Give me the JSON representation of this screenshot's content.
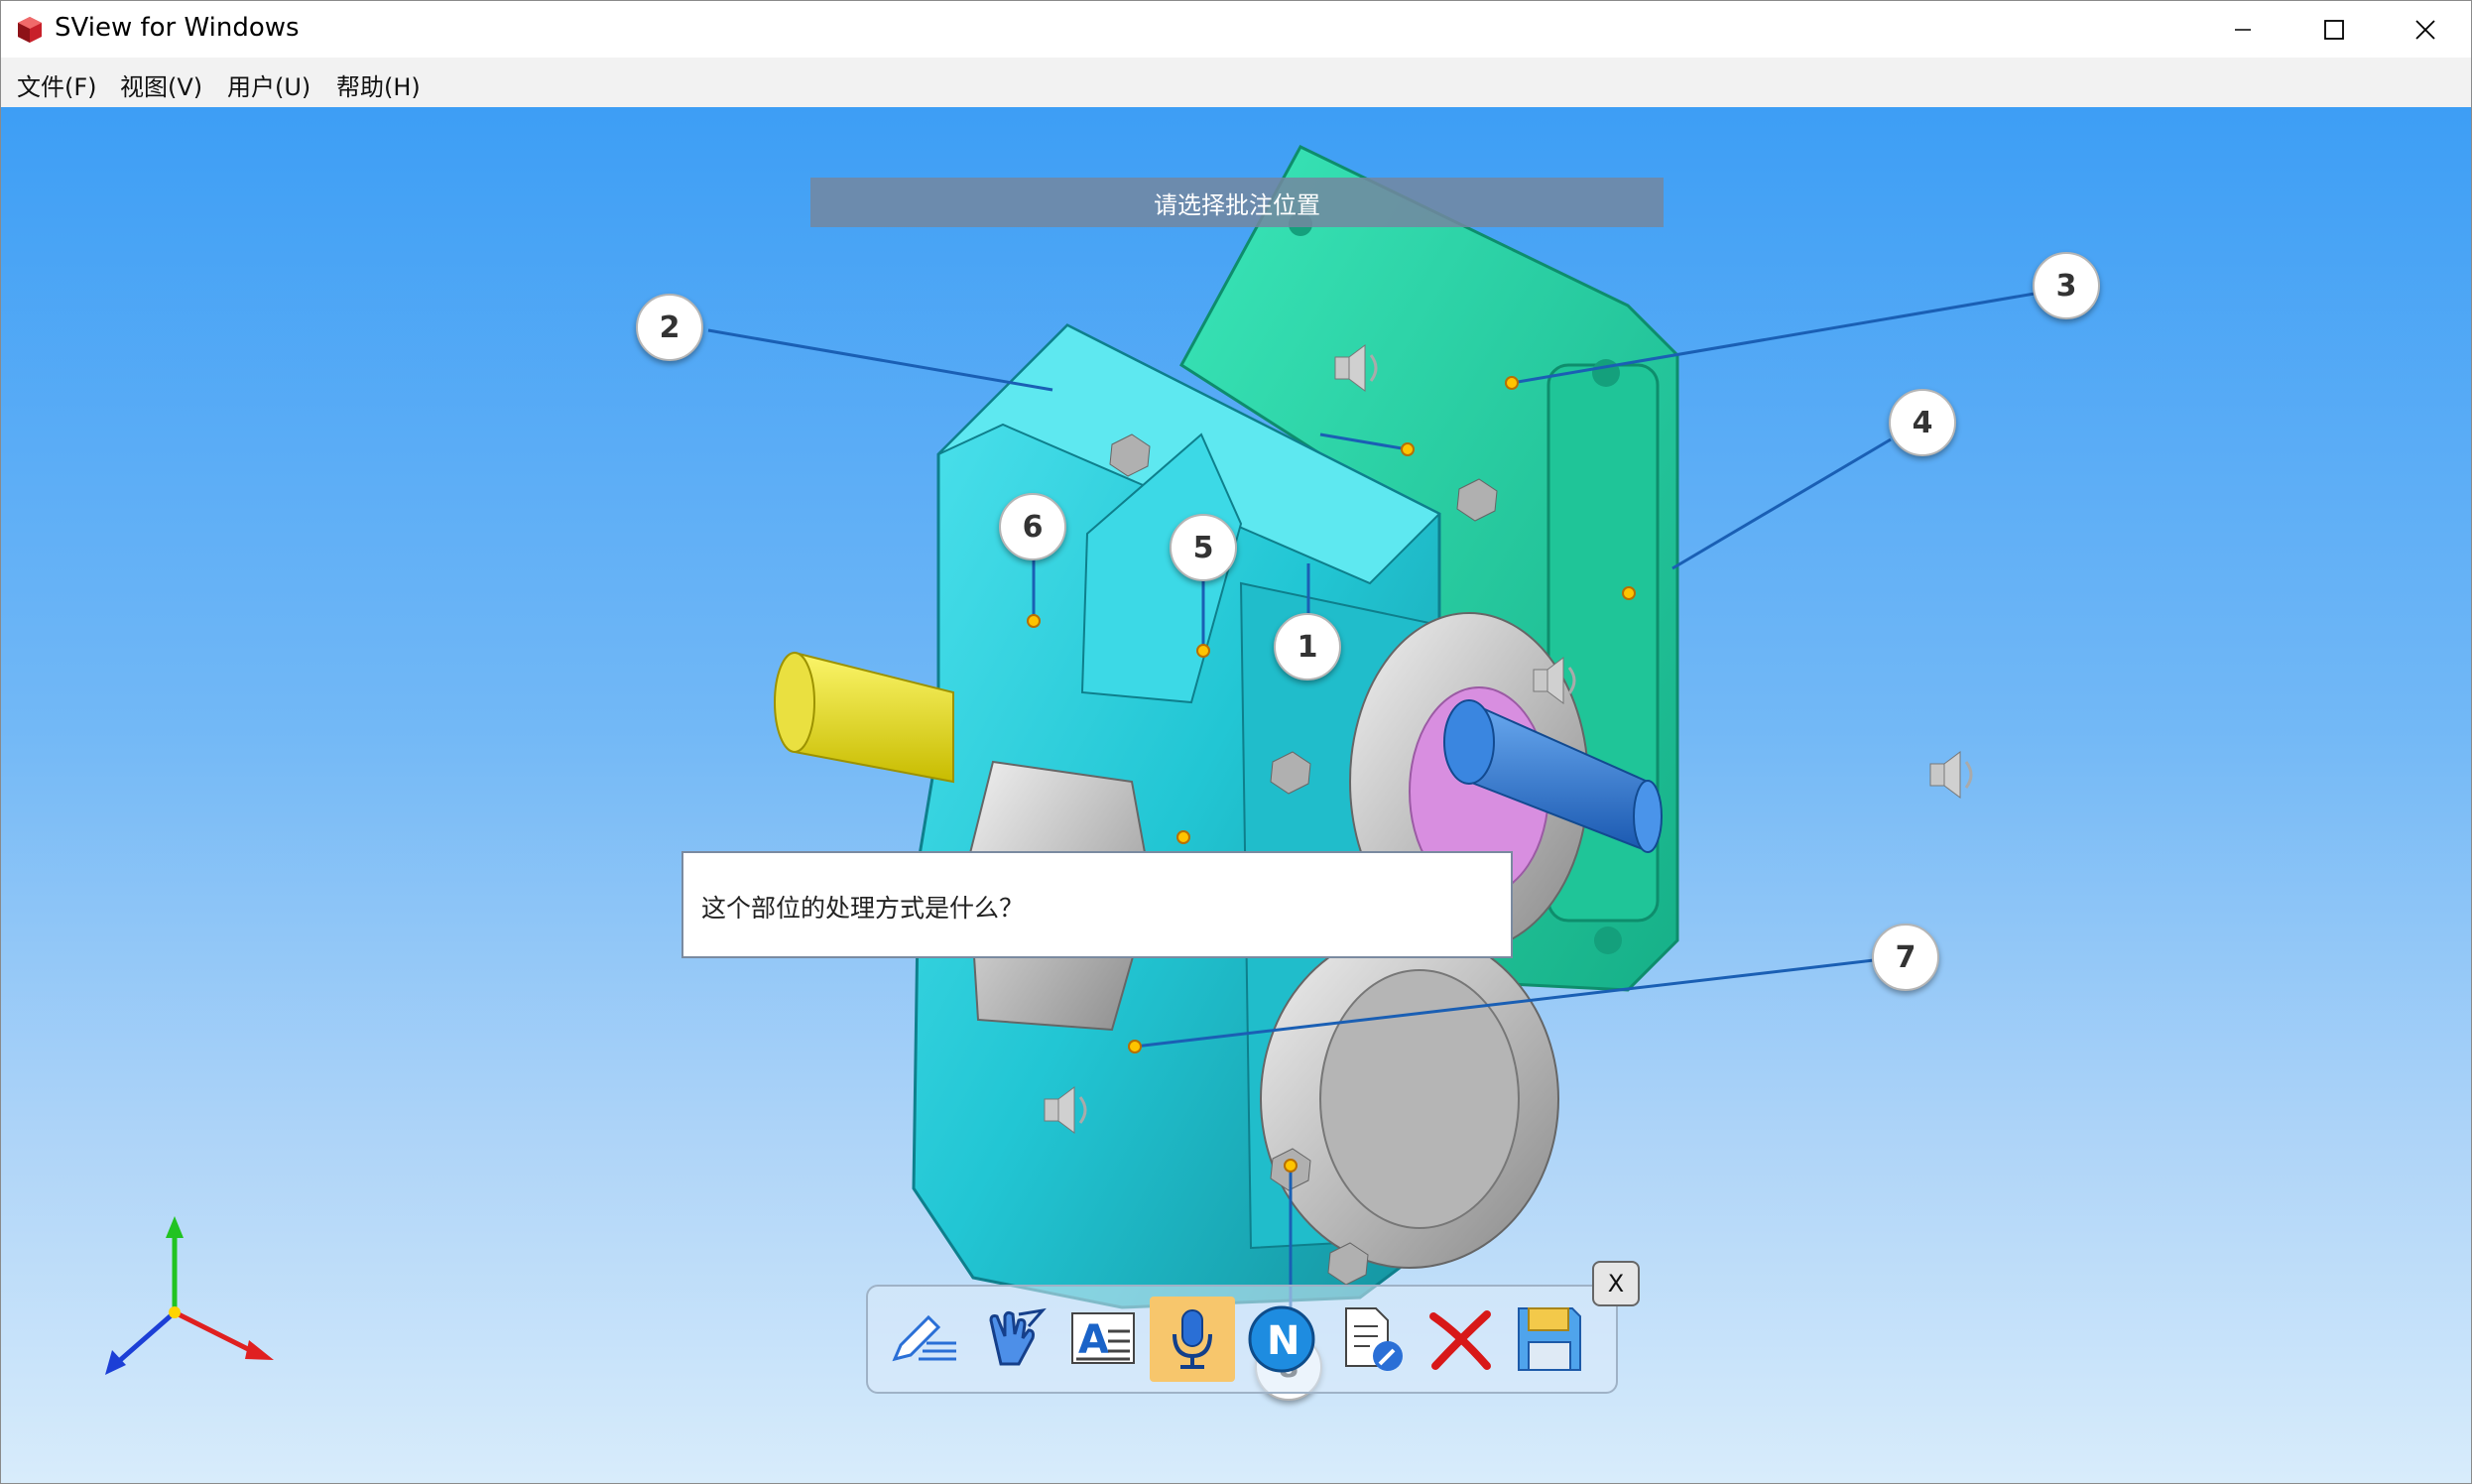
{
  "window": {
    "title": "SView for Windows"
  },
  "menu": [
    "文件(F)",
    "视图(V)",
    "用户(U)",
    "帮助(H)"
  ],
  "viewport": {
    "status_banner": "请选择批注位置",
    "note_text": "这个部位的处理方式是什么？",
    "balloons": [
      "1",
      "2",
      "3",
      "4",
      "5",
      "6",
      "7",
      "8"
    ],
    "toolbar_close": "X",
    "toolbar": [
      "pencil-annotation-icon",
      "hand-pointer-icon",
      "text-document-icon",
      "microphone-icon",
      "n-circle-icon",
      "document-edit-icon",
      "red-x-delete-icon",
      "floppy-save-icon"
    ],
    "active_tool": "microphone-icon"
  },
  "colors": {
    "housing": "#2ccfd8",
    "cover": "#27d5a4",
    "leader": "#1a5fb4",
    "point": "#ffc400",
    "shaft_yellow": "#f2e40a",
    "shaft_blue": "#2e7bd8",
    "active_tool": "#f7c66c"
  }
}
